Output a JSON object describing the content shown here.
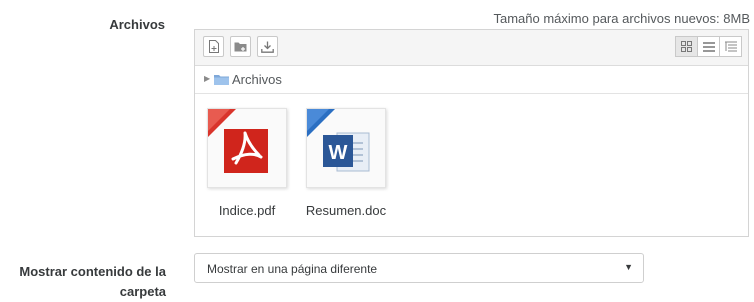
{
  "form": {
    "files_label": "Archivos",
    "max_size_text": "Tamaño máximo para archivos nuevos: 8MB",
    "display_label_line1": "Mostrar contenido de la",
    "display_label_line2": "carpeta",
    "display_select_value": "Mostrar en una página diferente"
  },
  "filepicker": {
    "toolbar": {
      "buttons": [
        "add-file-icon",
        "create-folder-icon",
        "download-icon"
      ],
      "views": [
        "icon-view-icon",
        "list-view-icon",
        "tree-view-icon"
      ],
      "active_view": "icon-view-icon"
    },
    "path": {
      "folder_name": "Archivos"
    },
    "files": [
      {
        "name": "Indice.pdf",
        "icon": "pdf-icon",
        "corner_color": "#d9342b"
      },
      {
        "name": "Resumen.doc",
        "icon": "word-doc-icon",
        "corner_color": "#2b6fc2"
      }
    ]
  }
}
